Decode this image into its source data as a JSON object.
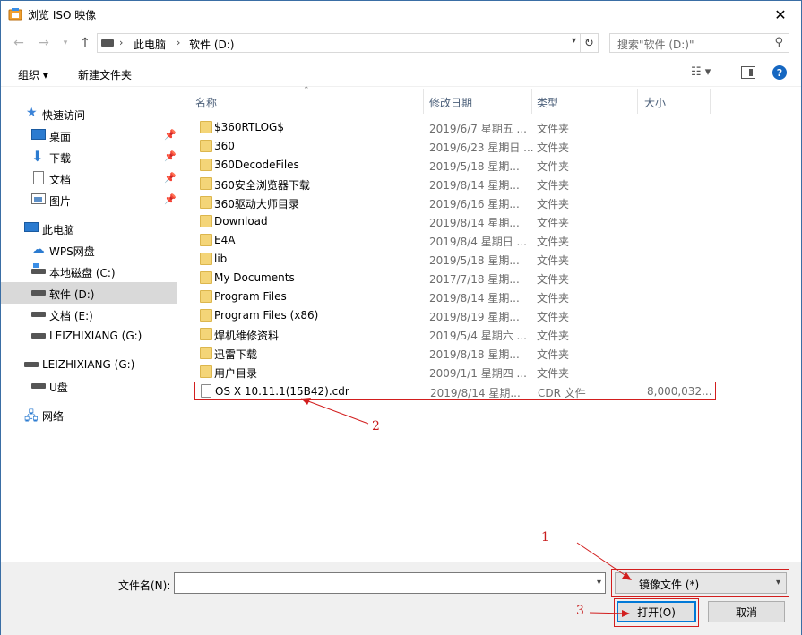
{
  "window": {
    "title": "浏览 ISO 映像"
  },
  "address": {
    "pc": "此电脑",
    "drive": "软件 (D:)"
  },
  "search": {
    "placeholder": "搜索\"软件 (D:)\""
  },
  "toolbar": {
    "organize": "组织 ▾",
    "new_folder": "新建文件夹",
    "help": "?"
  },
  "sidebar": {
    "items": [
      {
        "label": "快速访问"
      },
      {
        "label": "桌面"
      },
      {
        "label": "下载"
      },
      {
        "label": "文档"
      },
      {
        "label": "图片"
      },
      {
        "label": "此电脑"
      },
      {
        "label": "WPS网盘"
      },
      {
        "label": "本地磁盘 (C:)"
      },
      {
        "label": "软件 (D:)"
      },
      {
        "label": "文档 (E:)"
      },
      {
        "label": "LEIZHIXIANG (G:)"
      },
      {
        "label": "LEIZHIXIANG (G:)"
      },
      {
        "label": "U盘"
      },
      {
        "label": "网络"
      }
    ]
  },
  "columns": {
    "name": "名称",
    "date": "修改日期",
    "type": "类型",
    "size": "大小"
  },
  "files": [
    {
      "name": "$360RTLOG$",
      "date": "2019/6/7 星期五 ...",
      "type": "文件夹",
      "size": ""
    },
    {
      "name": "360",
      "date": "2019/6/23 星期日 ...",
      "type": "文件夹",
      "size": ""
    },
    {
      "name": "360DecodeFiles",
      "date": "2019/5/18 星期...",
      "type": "文件夹",
      "size": ""
    },
    {
      "name": "360安全浏览器下载",
      "date": "2019/8/14 星期...",
      "type": "文件夹",
      "size": ""
    },
    {
      "name": "360驱动大师目录",
      "date": "2019/6/16 星期...",
      "type": "文件夹",
      "size": ""
    },
    {
      "name": "Download",
      "date": "2019/8/14 星期...",
      "type": "文件夹",
      "size": ""
    },
    {
      "name": "E4A",
      "date": "2019/8/4 星期日 ...",
      "type": "文件夹",
      "size": ""
    },
    {
      "name": "lib",
      "date": "2019/5/18 星期...",
      "type": "文件夹",
      "size": ""
    },
    {
      "name": "My Documents",
      "date": "2017/7/18 星期...",
      "type": "文件夹",
      "size": ""
    },
    {
      "name": "Program Files",
      "date": "2019/8/14 星期...",
      "type": "文件夹",
      "size": ""
    },
    {
      "name": "Program Files (x86)",
      "date": "2019/8/19 星期...",
      "type": "文件夹",
      "size": ""
    },
    {
      "name": "焊机维修资料",
      "date": "2019/5/4 星期六 ...",
      "type": "文件夹",
      "size": ""
    },
    {
      "name": "迅雷下载",
      "date": "2019/8/18 星期...",
      "type": "文件夹",
      "size": ""
    },
    {
      "name": "用户目录",
      "date": "2009/1/1 星期四 ...",
      "type": "文件夹",
      "size": ""
    },
    {
      "name": "OS X 10.11.1(15B42).cdr",
      "date": "2019/8/14 星期...",
      "type": "CDR 文件",
      "size": "8,000,032..."
    }
  ],
  "bottom": {
    "filename_label": "文件名(N):",
    "filename_value": "",
    "filter": "镜像文件 (*)",
    "open": "打开(O)",
    "cancel": "取消"
  },
  "annotations": {
    "n1": "1",
    "n2": "2",
    "n3": "3"
  },
  "colors": {
    "accent": "#0078d7",
    "annotation": "#d21e1e",
    "folder": "#f4d578"
  }
}
